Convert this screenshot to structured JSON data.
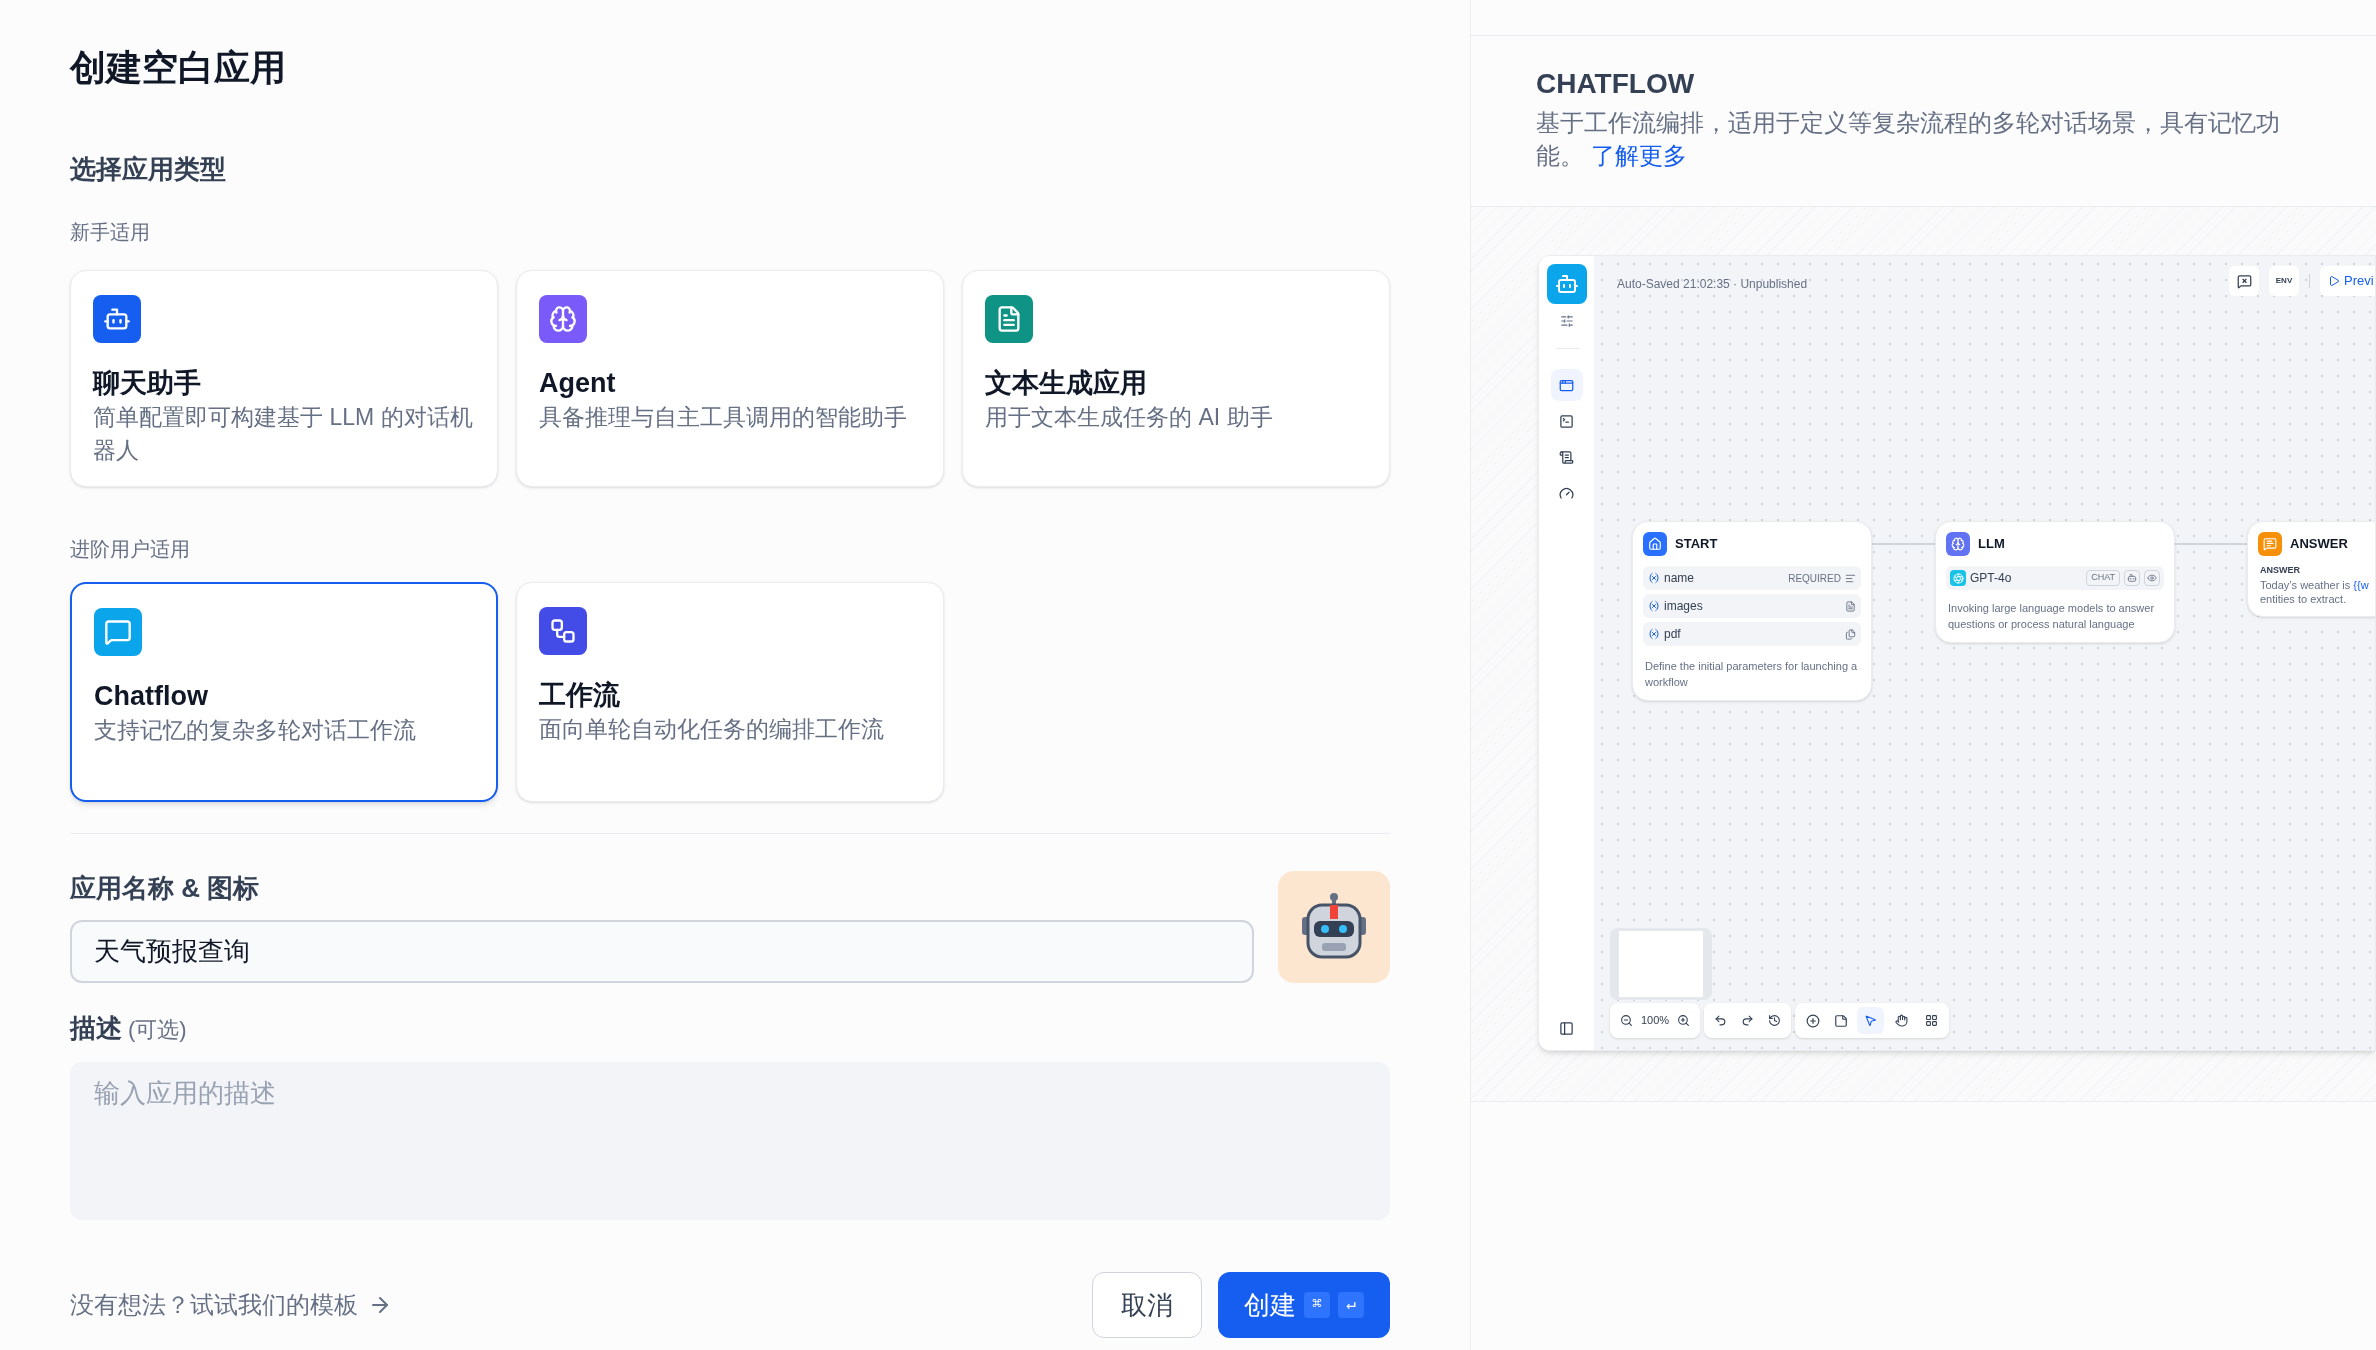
{
  "dialog": {
    "title": "创建空白应用"
  },
  "app_type": {
    "heading": "选择应用类型",
    "groups": [
      {
        "label": "新手适用",
        "cards": [
          {
            "kind": "chat",
            "title": "聊天助手",
            "description": "简单配置即可构建基于 LLM 的对话机器人",
            "selected": false
          },
          {
            "kind": "agent",
            "title": "Agent",
            "description": "具备推理与自主工具调用的智能助手",
            "selected": false
          },
          {
            "kind": "completion",
            "title": "文本生成应用",
            "description": "用于文本生成任务的 AI 助手",
            "selected": false
          }
        ]
      },
      {
        "label": "进阶用户适用",
        "cards": [
          {
            "kind": "chatflow",
            "title": "Chatflow",
            "description": "支持记忆的复杂多轮对话工作流",
            "selected": true
          },
          {
            "kind": "workflow",
            "title": "工作流",
            "description": "面向单轮自动化任务的编排工作流",
            "selected": false
          }
        ]
      }
    ]
  },
  "name_field": {
    "label": "应用名称 & 图标",
    "value": "天气预报查询"
  },
  "description_field": {
    "label": "描述",
    "hint": "(可选)",
    "placeholder": "输入应用的描述"
  },
  "footer": {
    "template_link": "没有想法？试试我们的模板",
    "cancel": "取消",
    "create": "创建",
    "shortcut_keys": [
      "⌘",
      "↵"
    ]
  },
  "preview": {
    "title": "CHATFLOW",
    "description": "基于工作流编排，适用于定义等复杂流程的多轮对话场景，具有记忆功能。",
    "learn_more": "了解更多",
    "window": {
      "status": "Auto-Saved 21:02:35 · Unpublished",
      "env_label": "ENV",
      "preview_button": "Previ",
      "sidebar_items": [
        {
          "kind": "app",
          "selected": true
        },
        {
          "kind": "terminal",
          "selected": false
        },
        {
          "kind": "logs",
          "selected": false
        },
        {
          "kind": "monitor",
          "selected": false
        }
      ],
      "nodes": [
        {
          "kind": "start",
          "title": "START",
          "variables": [
            {
              "name": "name",
              "tag": "REQUIRED",
              "kind": "text"
            },
            {
              "name": "images",
              "kind": "paragraph"
            },
            {
              "name": "pdf",
              "kind": "files"
            }
          ],
          "description": "Define the initial parameters for launching a workflow"
        },
        {
          "kind": "llm",
          "title": "LLM",
          "model": "GPT-4o",
          "mode": "CHAT",
          "description": "Invoking large language models to answer questions or process natural language"
        },
        {
          "kind": "answer",
          "title": "ANSWER",
          "field_label": "ANSWER",
          "text_before": "Today’s weather is ",
          "variable": "{{w",
          "text_after": "entities to extract."
        }
      ],
      "zoom": "100%",
      "tools": [
        {
          "kind": "pointer",
          "selected": true
        },
        {
          "kind": "hand",
          "selected": false
        }
      ]
    }
  }
}
